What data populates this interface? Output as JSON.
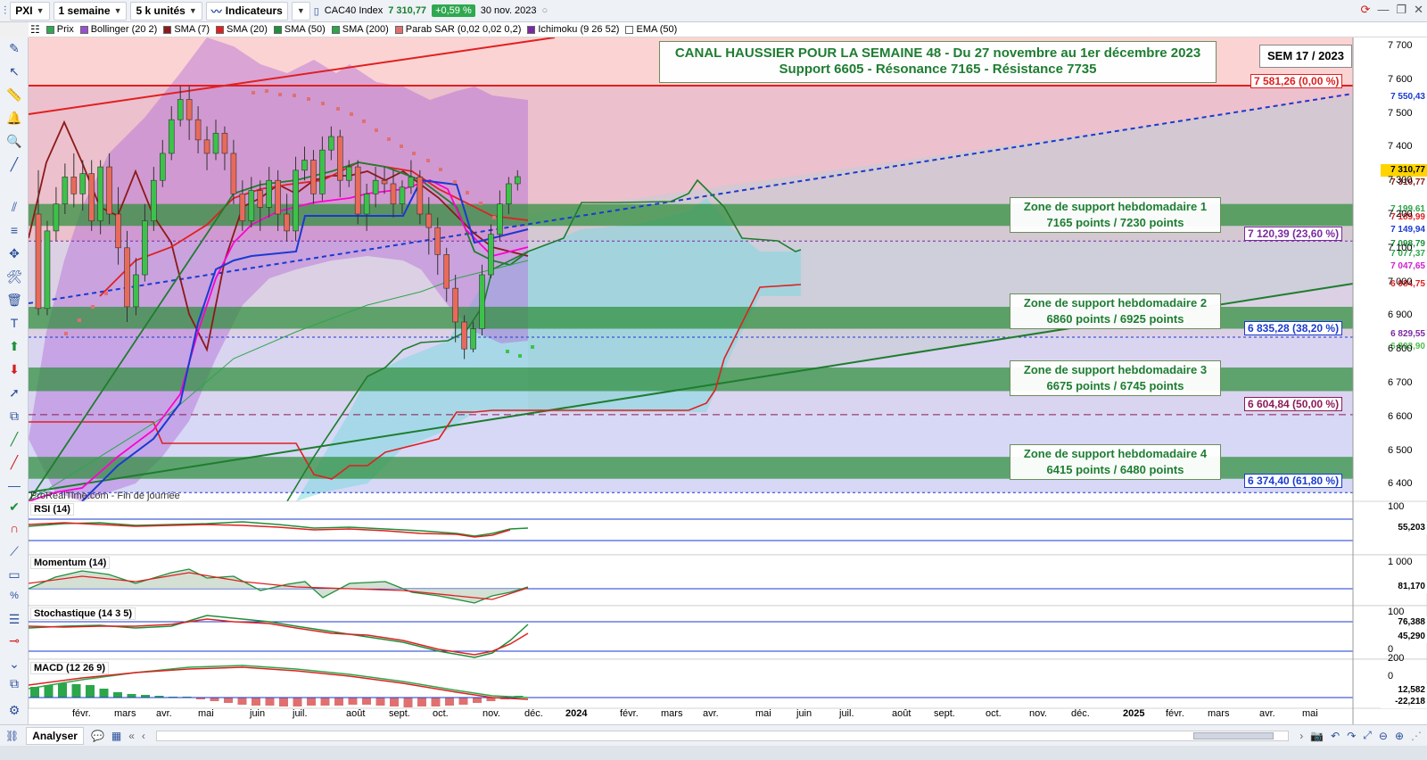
{
  "toolbar": {
    "ticker": "PXI",
    "period": "1 semaine",
    "units": "5 k unités",
    "indicators_btn": "Indicateurs",
    "instrument": "CAC40 Index",
    "last": "7 310,77",
    "change": "+0,59 %",
    "date": "30 nov. 2023"
  },
  "indicators": [
    {
      "label": "Prix",
      "color": "#2fa84f"
    },
    {
      "label": "Bollinger (20 2)",
      "color": "#9b4fd0"
    },
    {
      "label": "SMA (7)",
      "color": "#8b1a1a"
    },
    {
      "label": "SMA (20)",
      "color": "#e02020"
    },
    {
      "label": "SMA (50)",
      "color": "#1e8f3a"
    },
    {
      "label": "SMA (200)",
      "color": "#2ca64a"
    },
    {
      "label": "Parab SAR (0,02 0,02 0,2)",
      "color": "#e07070"
    },
    {
      "label": "Ichimoku (9 26 52)",
      "color": "#7a2aa0"
    },
    {
      "label": "EMA (50)",
      "color": "#ffffff"
    }
  ],
  "main_chart": {
    "headline_1": "CANAL HAUSSIER POUR LA SEMAINE 48 - Du 27 novembre au 1er décembre 2023",
    "headline_2": "Support 6605 - Résonance 7165 - Résistance 7735",
    "week_badge": "SEM 17 / 2023",
    "source": "ProRealTime.com - Fin de journée",
    "zones": [
      {
        "title": "Zone de support hebdomadaire 1",
        "range": "7165 points / 7230 points"
      },
      {
        "title": "Zone de support hebdomadaire 2",
        "range": "6860 points / 6925 points"
      },
      {
        "title": "Zone de support hebdomadaire 3",
        "range": "6675 points / 6745 points"
      },
      {
        "title": "Zone de support hebdomadaire 4",
        "range": "6415 points / 6480 points"
      }
    ],
    "fibo": [
      {
        "label": "7 581,26 (0,00 %)",
        "color": "#e02020"
      },
      {
        "label": "7 120,39 (23,60 %)",
        "color": "#7a2aa0"
      },
      {
        "label": "6 835,28 (38,20 %)",
        "color": "#1a3ad0"
      },
      {
        "label": "6 604,84 (50,00 %)",
        "color": "#8b1a5a"
      },
      {
        "label": "6 374,40 (61,80 %)",
        "color": "#1a3ad0"
      }
    ],
    "y_axis": [
      "7 700",
      "7 600",
      "7 500",
      "7 400",
      "7 300",
      "7 200",
      "7 100",
      "7 000",
      "6 900",
      "6 800",
      "6 700",
      "6 600",
      "6 500",
      "6 400"
    ],
    "price_labels": [
      {
        "text": "7 550,43",
        "color": "#1a3ad0"
      },
      {
        "text": "7 310,77",
        "color": "#000000",
        "bg": "#ffd400"
      },
      {
        "text": "7 310,77",
        "color": "#8b1a1a"
      },
      {
        "text": "7 199,61",
        "color": "#2ca64a"
      },
      {
        "text": "7 189,99",
        "color": "#e02020"
      },
      {
        "text": "7 149,94",
        "color": "#1a3ad0"
      },
      {
        "text": "7 098,79",
        "color": "#1e8f3a"
      },
      {
        "text": "7 077,37",
        "color": "#2ca64a"
      },
      {
        "text": "7 047,65",
        "color": "#d020d0"
      },
      {
        "text": "6 984,75",
        "color": "#e02020"
      },
      {
        "text": "6 829,55",
        "color": "#7a2aa0"
      },
      {
        "text": "6 803,90",
        "color": "#50c050"
      }
    ]
  },
  "sub_panels": [
    {
      "title": "RSI (14)",
      "value": "55,203",
      "value_color": "#1e8f3a",
      "axis_top": "100",
      "axis_bottom": "0"
    },
    {
      "title": "Momentum (14)",
      "value": "81,170",
      "value_color": "#e02020",
      "axis_top": "1 000",
      "axis_bottom": "-1 000"
    },
    {
      "title": "Stochastique (14 3 5)",
      "value": "76,388",
      "value_color": "#1e8f3a",
      "value2": "45,290",
      "value2_color": "#e07070",
      "axis_top": "100",
      "axis_bottom": "0"
    },
    {
      "title": "MACD (12 26 9)",
      "value": "12,582",
      "value_color": "#50c050",
      "value2": "-22,218",
      "value2_color": "#e02020",
      "axis_top": "200",
      "axis_bottom": "0"
    }
  ],
  "time_axis": [
    "févr.",
    "mars",
    "avr.",
    "mai",
    "juin",
    "juil.",
    "août",
    "sept.",
    "oct.",
    "nov.",
    "déc.",
    "2024",
    "févr.",
    "mars",
    "avr.",
    "mai",
    "juin",
    "juil.",
    "août",
    "sept.",
    "oct.",
    "nov.",
    "déc.",
    "2025",
    "févr.",
    "mars",
    "avr.",
    "mai"
  ],
  "bottom": {
    "analyser": "Analyser"
  },
  "colors": {
    "up": "#3cc24a",
    "down": "#e86a5a",
    "resistance": "#e02020",
    "channel": "#1a3ad0"
  }
}
